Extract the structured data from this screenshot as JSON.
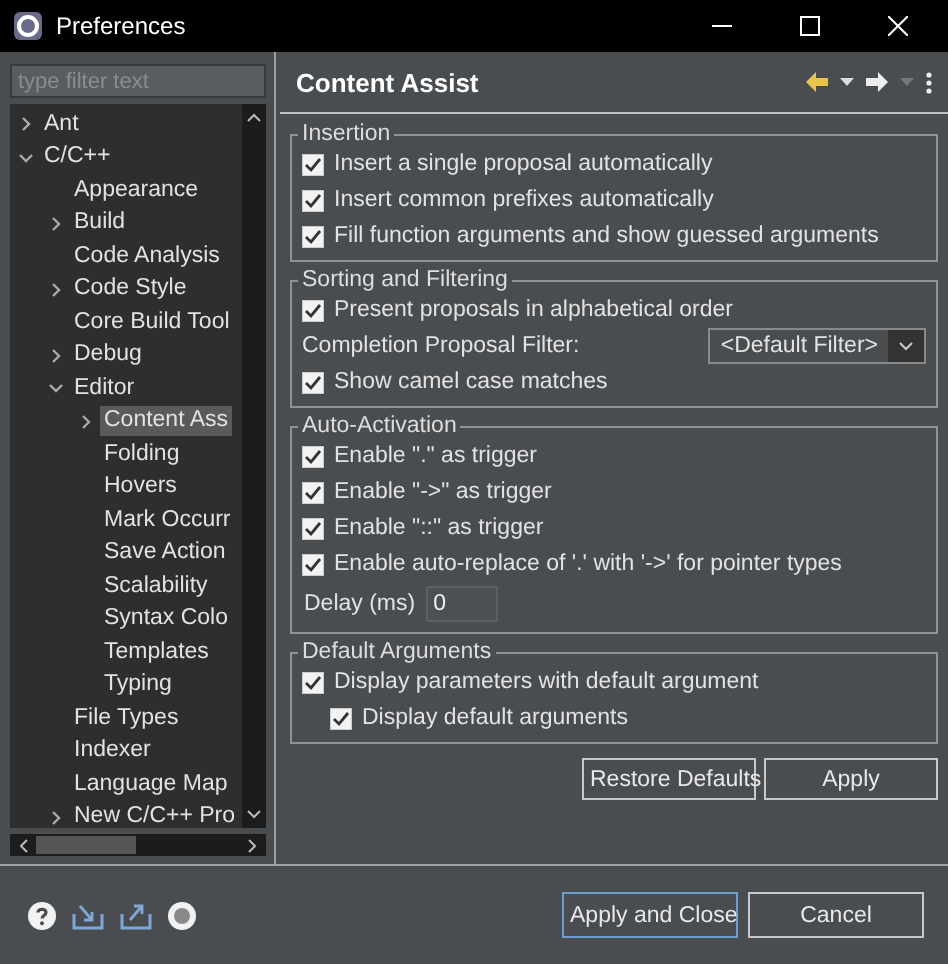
{
  "window": {
    "title": "Preferences"
  },
  "filter": {
    "placeholder": "type filter text"
  },
  "tree": [
    {
      "label": "Ant",
      "expanded": false,
      "selected": false
    },
    {
      "label": "C/C++",
      "expanded": true,
      "selected": false,
      "children": [
        {
          "label": "Appearance",
          "selected": false
        },
        {
          "label": "Build",
          "expanded": false,
          "selected": false
        },
        {
          "label": "Code Analysis",
          "selected": false
        },
        {
          "label": "Code Style",
          "expanded": false,
          "selected": false
        },
        {
          "label": "Core Build Tool",
          "selected": false
        },
        {
          "label": "Debug",
          "expanded": false,
          "selected": false
        },
        {
          "label": "Editor",
          "expanded": true,
          "selected": false,
          "children": [
            {
              "label": "Content Ass",
              "expanded": false,
              "selected": true
            },
            {
              "label": "Folding",
              "selected": false
            },
            {
              "label": "Hovers",
              "selected": false
            },
            {
              "label": "Mark Occurr",
              "selected": false
            },
            {
              "label": "Save Action",
              "selected": false
            },
            {
              "label": "Scalability",
              "selected": false
            },
            {
              "label": "Syntax Colo",
              "selected": false
            },
            {
              "label": "Templates",
              "selected": false
            },
            {
              "label": "Typing",
              "selected": false
            }
          ]
        },
        {
          "label": "File Types",
          "selected": false
        },
        {
          "label": "Indexer",
          "selected": false
        },
        {
          "label": "Language Map",
          "selected": false
        },
        {
          "label": "New C/C++ Pro",
          "expanded": false,
          "selected": false
        }
      ]
    }
  ],
  "page": {
    "title": "Content Assist",
    "groups": [
      {
        "title": "Insertion",
        "items": [
          {
            "kind": "checkbox",
            "label": "Insert a single proposal automatically",
            "checked": true
          },
          {
            "kind": "checkbox",
            "label": "Insert common prefixes automatically",
            "checked": true
          },
          {
            "kind": "checkbox",
            "label": "Fill function arguments and show guessed arguments",
            "checked": true
          }
        ]
      },
      {
        "title": "Sorting and Filtering",
        "items": [
          {
            "kind": "checkbox",
            "label": "Present proposals in alphabetical order",
            "checked": true
          },
          {
            "kind": "select",
            "label": "Completion Proposal Filter:",
            "value": "<Default Filter>"
          },
          {
            "kind": "checkbox",
            "label": "Show camel case matches",
            "checked": true
          }
        ]
      },
      {
        "title": "Auto-Activation",
        "items": [
          {
            "kind": "checkbox",
            "label": "Enable \".\" as trigger",
            "checked": true
          },
          {
            "kind": "checkbox",
            "label": "Enable \"->\" as trigger",
            "checked": true
          },
          {
            "kind": "checkbox",
            "label": "Enable \"::\" as trigger",
            "checked": true
          },
          {
            "kind": "checkbox",
            "label": "Enable auto-replace of '.' with '->' for pointer types",
            "checked": true
          },
          {
            "kind": "number",
            "label": "Delay (ms)",
            "value": "0"
          }
        ]
      },
      {
        "title": "Default Arguments",
        "items": [
          {
            "kind": "checkbox",
            "label": "Display parameters with default argument",
            "checked": true,
            "children": [
              {
                "kind": "checkbox",
                "label": "Display default arguments",
                "checked": true
              }
            ]
          }
        ]
      }
    ]
  },
  "page_buttons": [
    "Restore Defaults",
    "Apply"
  ],
  "dialog_buttons": [
    {
      "label": "Apply and Close",
      "default": true
    },
    {
      "label": "Cancel",
      "default": false
    }
  ]
}
